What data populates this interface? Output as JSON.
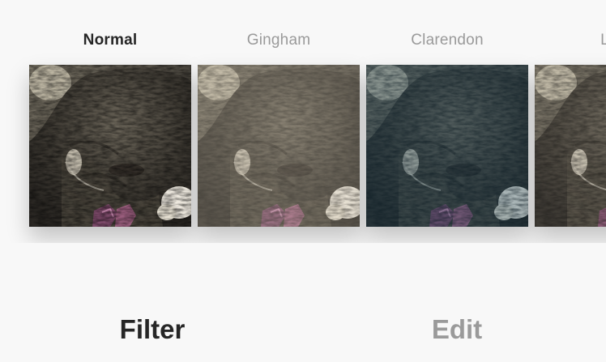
{
  "filters": [
    {
      "label": "Normal",
      "selected": true,
      "tint": "#000000",
      "tint_opacity": 0
    },
    {
      "label": "Gingham",
      "selected": false,
      "tint": "#d8ccb8",
      "tint_opacity": 0.28
    },
    {
      "label": "Clarendon",
      "selected": false,
      "tint": "#1b4a63",
      "tint_opacity": 0.32
    },
    {
      "label": "Lark",
      "selected": false,
      "tint": "#e9e2d0",
      "tint_opacity": 0.1
    }
  ],
  "tabs": {
    "filter_label": "Filter",
    "edit_label": "Edit",
    "active": "filter"
  },
  "colors": {
    "background": "#f8f8f8",
    "selected_text": "#262626",
    "unselected_text": "#9a9a9a"
  },
  "icons": {
    "thumbnail_subject": "cat-photo"
  }
}
